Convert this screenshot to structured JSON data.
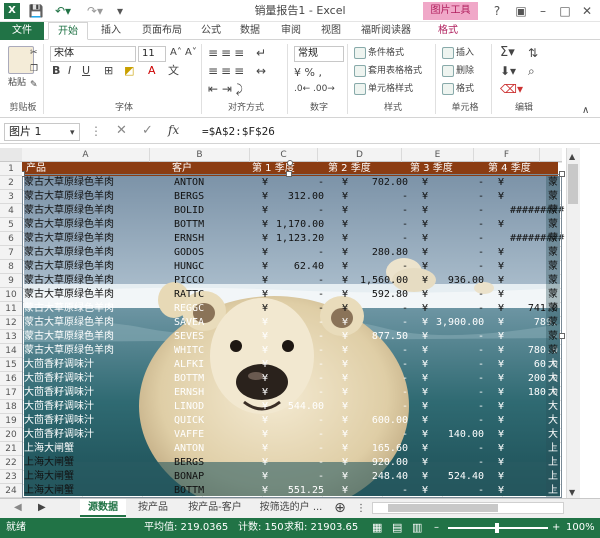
{
  "window": {
    "title": "销量报告1 - Excel",
    "picture_tools": "图片工具"
  },
  "ribbon_tabs": [
    "文件",
    "开始",
    "插入",
    "页面布局",
    "公式",
    "数据",
    "审阅",
    "视图",
    "福昕阅读器",
    "格式"
  ],
  "ribbon": {
    "paste": "粘贴",
    "font_name": "宋体",
    "font_size": "11",
    "number_format": "常规",
    "conditional_format": "条件格式",
    "table_format": "套用表格格式",
    "cell_style": "单元格样式",
    "insert": "插入",
    "delete": "删除",
    "format": "格式",
    "groups": {
      "clipboard": "剪贴板",
      "font": "字体",
      "alignment": "对齐方式",
      "number": "数字",
      "styles": "样式",
      "cells": "单元格",
      "editing": "编辑"
    }
  },
  "formula_bar": {
    "name_box": "图片 1",
    "formula": "=$A$2:$F$26",
    "fx": "fx"
  },
  "columns": [
    "A",
    "B",
    "C",
    "D",
    "E",
    "F"
  ],
  "rows": [
    "1",
    "2",
    "3",
    "4",
    "5",
    "6",
    "7",
    "8",
    "9",
    "10",
    "11",
    "12",
    "13",
    "14",
    "15",
    "16",
    "17",
    "18",
    "19",
    "20",
    "21",
    "22",
    "23",
    "24"
  ],
  "header_row": [
    "产品",
    "客户",
    "第 1 季度",
    "第 2 季度",
    "第 3 季度",
    "第 4 季度"
  ],
  "table_rows": [
    [
      "蒙古大草原绿色羊肉",
      "ANTON",
      "¥",
      "-",
      "¥",
      "702.00",
      "¥",
      "-",
      "¥",
      "-"
    ],
    [
      "蒙古大草原绿色羊肉",
      "BERGS",
      "¥",
      "312.00",
      "¥",
      "-",
      "¥",
      "-",
      "¥",
      "-"
    ],
    [
      "蒙古大草原绿色羊肉",
      "BOLID",
      "¥",
      "-",
      "¥",
      "-",
      "¥",
      "-",
      "",
      "#########"
    ],
    [
      "蒙古大草原绿色羊肉",
      "BOTTM",
      "¥",
      "1,170.00",
      "¥",
      "-",
      "¥",
      "-",
      "¥",
      "-"
    ],
    [
      "蒙古大草原绿色羊肉",
      "ERNSH",
      "¥",
      "1,123.20",
      "¥",
      "-",
      "¥",
      "-",
      "",
      "#########"
    ],
    [
      "蒙古大草原绿色羊肉",
      "GODOS",
      "¥",
      "-",
      "¥",
      "280.80",
      "¥",
      "-",
      "¥",
      "-"
    ],
    [
      "蒙古大草原绿色羊肉",
      "HUNGC",
      "¥",
      "62.40",
      "¥",
      "-",
      "¥",
      "-",
      "¥",
      "-"
    ],
    [
      "蒙古大草原绿色羊肉",
      "PICCO",
      "¥",
      "-",
      "¥",
      "1,560.00",
      "¥",
      "936.00",
      "¥",
      "-"
    ],
    [
      "蒙古大草原绿色羊肉",
      "RATTC",
      "¥",
      "-",
      "¥",
      "592.80",
      "¥",
      "-",
      "¥",
      "-"
    ],
    [
      "蒙古大草原绿色羊肉",
      "REGGC",
      "¥",
      "-",
      "¥",
      "-",
      "¥",
      "-",
      "¥",
      "741.0"
    ],
    [
      "蒙古大草原绿色羊肉",
      "SAVEA",
      "¥",
      "-",
      "¥",
      "-",
      "¥",
      "3,900.00",
      "¥",
      "789."
    ],
    [
      "蒙古大草原绿色羊肉",
      "SEVES",
      "¥",
      "-",
      "¥",
      "877.50",
      "¥",
      "-",
      "¥",
      "-"
    ],
    [
      "蒙古大草原绿色羊肉",
      "WHITC",
      "¥",
      "-",
      "¥",
      "-",
      "¥",
      "-",
      "¥",
      "780.0"
    ],
    [
      "大茴香籽调味汁",
      "ALFKI",
      "¥",
      "-",
      "¥",
      "-",
      "¥",
      "-",
      "¥",
      "60.0"
    ],
    [
      "大茴香籽调味汁",
      "BOTTM",
      "¥",
      "-",
      "¥",
      "-",
      "¥",
      "-",
      "¥",
      "200.0"
    ],
    [
      "大茴香籽调味汁",
      "ERNSH",
      "¥",
      "-",
      "¥",
      "-",
      "¥",
      "-",
      "¥",
      "180.0"
    ],
    [
      "大茴香籽调味汁",
      "LINOD",
      "¥",
      "544.00",
      "¥",
      "-",
      "¥",
      "-",
      "¥",
      "-"
    ],
    [
      "大茴香籽调味汁",
      "QUICK",
      "¥",
      "-",
      "¥",
      "600.00",
      "¥",
      "-",
      "¥",
      "-"
    ],
    [
      "大茴香籽调味汁",
      "VAFFE",
      "¥",
      "-",
      "¥",
      "-",
      "¥",
      "140.00",
      "¥",
      "-"
    ],
    [
      "上海大闸蟹",
      "ANTON",
      "¥",
      "-",
      "¥",
      "165.60",
      "¥",
      "-",
      "¥",
      "-"
    ],
    [
      "上海大闸蟹",
      "BERGS",
      "¥",
      "-",
      "¥",
      "920.00",
      "¥",
      "-",
      "¥",
      "-"
    ],
    [
      "上海大闸蟹",
      "BONAP",
      "¥",
      "-",
      "¥",
      "248.40",
      "¥",
      "524.40",
      "¥",
      "-"
    ],
    [
      "上海大闸蟹",
      "BOTTM",
      "¥",
      "551.25",
      "¥",
      "-",
      "¥",
      "-",
      "¥",
      "-"
    ]
  ],
  "right_strip": [
    "蒙",
    "蒙",
    "蒙",
    "蒙",
    "蒙",
    "蒙",
    "蒙",
    "蒙",
    "蒙",
    "蒙",
    "蒙",
    "蒙",
    "蒙",
    "大",
    "大",
    "大",
    "大",
    "大",
    "大",
    "上",
    "上",
    "上",
    "上"
  ],
  "sheet_tabs": [
    "源数据",
    "按产品",
    "按产品-客户",
    "按筛选的户 ..."
  ],
  "status": {
    "mode": "就绪",
    "average": "平均值: 219.0365",
    "count": "计数: 150",
    "sum": "求和: 21903.65",
    "zoom": "100%"
  },
  "colors": {
    "excel_green": "#217346",
    "header_row_fill": "#8b3c12",
    "picture_tools": "#b0205e"
  }
}
